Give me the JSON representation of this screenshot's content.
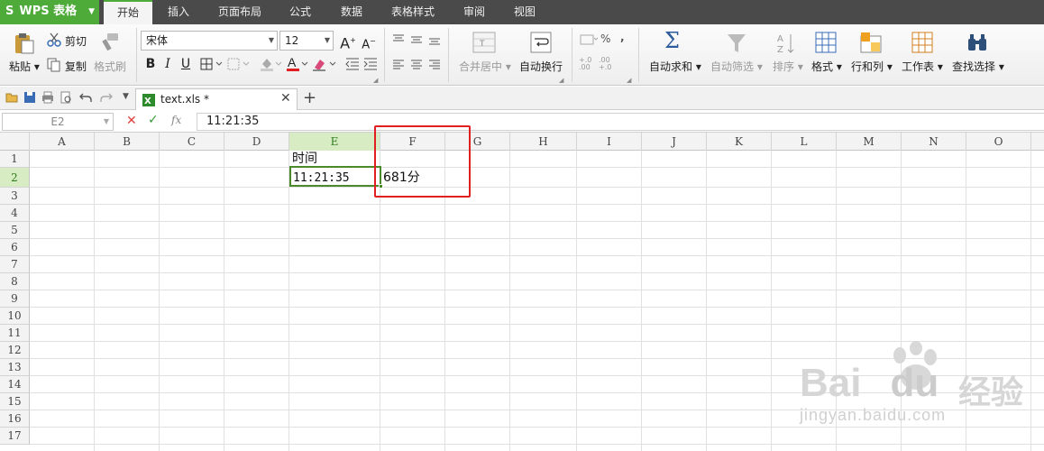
{
  "app": {
    "name": "WPS 表格",
    "menu_tabs": [
      "开始",
      "插入",
      "页面布局",
      "公式",
      "数据",
      "表格样式",
      "审阅",
      "视图"
    ],
    "active_tab": "开始"
  },
  "ribbon": {
    "clipboard": {
      "paste": "粘贴",
      "cut": "剪切",
      "copy": "复制",
      "format_painter": "格式刷"
    },
    "font": {
      "name": "宋体",
      "size": "12",
      "bold": "B",
      "italic": "I",
      "underline": "U",
      "grow": "A",
      "shrink": "A"
    },
    "alignment": {
      "merge_center": "合并居中",
      "wrap_text": "自动换行"
    },
    "number": {
      "percent": "%",
      "comma": ",",
      "inc_decimal": "+.0 .00",
      "dec_decimal": ".00 +.0"
    },
    "editing": {
      "autosum": "自动求和",
      "autofilter": "自动筛选",
      "sort": "排序",
      "format": "格式",
      "rows_cols": "行和列",
      "worksheet": "工作表",
      "find_select": "查找选择"
    }
  },
  "document": {
    "tab_title": "text.xls *"
  },
  "formula_bar": {
    "name_box": "E2",
    "fx": "fx",
    "value": "11:21:35"
  },
  "sheet": {
    "columns": [
      "A",
      "B",
      "C",
      "D",
      "E",
      "F",
      "G",
      "H",
      "I",
      "J",
      "K",
      "L",
      "M",
      "N",
      "O"
    ],
    "rows": [
      "1",
      "2",
      "3",
      "4",
      "5",
      "6",
      "7",
      "8",
      "9",
      "10",
      "11",
      "12",
      "13",
      "14",
      "15",
      "16",
      "17"
    ],
    "selected_cell": "E2",
    "cells": {
      "E1": "时间",
      "E2": "11:21:35",
      "F2": "681分"
    }
  },
  "watermark": {
    "brand": "Bai",
    "brand2": "du",
    "cn": "经验",
    "url": "jingyan.baidu.com"
  },
  "colors": {
    "wps_green": "#4eab3a",
    "menubar": "#4a4a4a",
    "highlight_red": "#e02020",
    "selection_green": "#4a8a2a"
  }
}
